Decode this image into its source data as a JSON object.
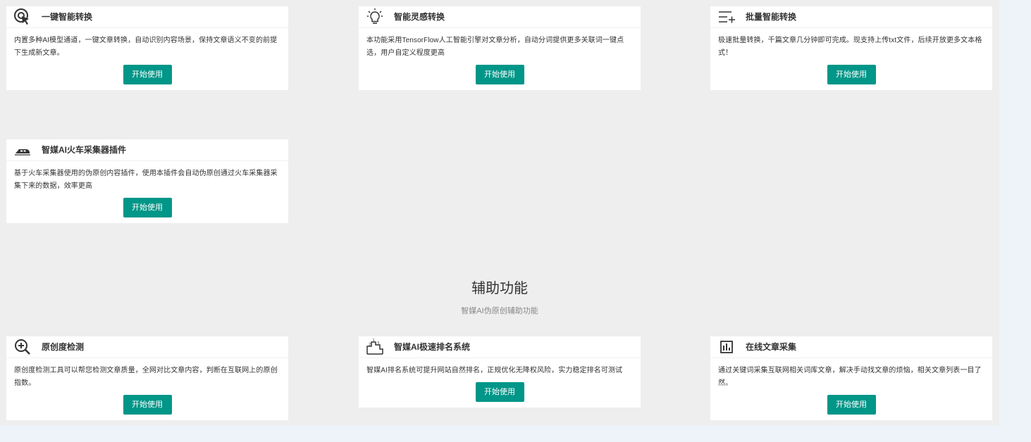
{
  "colors": {
    "accent": "#009688",
    "panel": "#eeeeee",
    "page": "#eef2f9"
  },
  "section1": {
    "cards": [
      {
        "icon": "cursor-click-icon",
        "title": "一键智能转换",
        "desc": "内置多种AI模型通道，一键文章转换，自动识别内容场景，保持文章语义不变的前提下生成新文章。",
        "button": "开始使用"
      },
      {
        "icon": "lightbulb-icon",
        "title": "智能灵感转换",
        "desc": "本功能采用TensorFlow人工智能引擎对文章分析，自动分词提供更多关联词一键点选，用户自定义程度更高",
        "button": "开始使用"
      },
      {
        "icon": "list-add-icon",
        "title": "批量智能转换",
        "desc": "极速批量转换，千篇文章几分钟即可完成。现支持上传txt文件，后续开放更多文本格式！",
        "button": "开始使用"
      },
      {
        "icon": "train-icon",
        "title": "智媒AI火车采集器插件",
        "desc": "基于火车采集器使用的伪原创内容插件，使用本插件会自动伪原创通过火车采集器采集下来的数据，效率更高",
        "button": "开始使用"
      }
    ]
  },
  "section2": {
    "title": "辅助功能",
    "subtitle": "智媒AI伪原创辅助功能",
    "cards": [
      {
        "icon": "magnifier-plus-icon",
        "title": "原创度检测",
        "desc": "原创度检测工具可以帮您检测文章质量，全网对比文章内容，判断在互联网上的原创指数。",
        "button": "开始使用"
      },
      {
        "icon": "ranking-icon",
        "title": "智媒AI极速排名系统",
        "desc": "智媒AI排名系统可提升网站自然排名，正规优化无降权风险，实力稳定排名可测试",
        "button": "开始使用"
      },
      {
        "icon": "bar-chart-icon",
        "title": "在线文章采集",
        "desc": "通过关键词采集互联网相关词库文章，解决手动找文章的烦恼，相关文章列表一目了然。",
        "button": "开始使用"
      }
    ]
  }
}
